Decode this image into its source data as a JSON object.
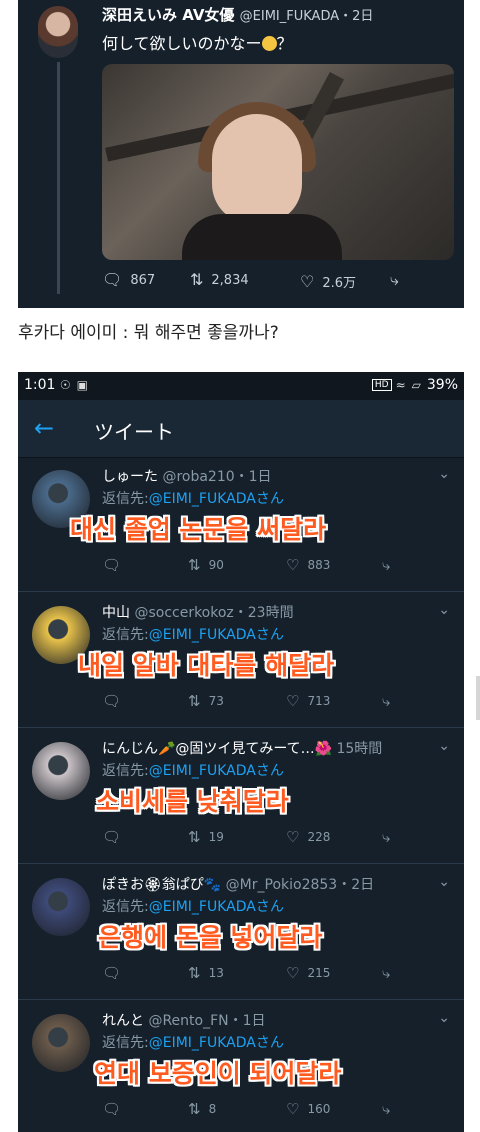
{
  "top_tweet": {
    "name": "深田えいみ AV女優",
    "handle": "@EIMI_FUKADA・2日",
    "text": "何して欲しいのかなー",
    "text_suffix": "？",
    "stats": {
      "replies": "867",
      "retweets": "2,834",
      "likes": "2.6万"
    }
  },
  "caption": "후카다 에이미 : 뭐 해주면 좋을까나?",
  "phone": {
    "status_time": "1:01",
    "status_hd": "HD",
    "status_battery": "39%",
    "header_title": "ツイート",
    "reply_to_label": "返信先:",
    "reply_to_user": "@EIMI_FUKADAさん",
    "replies": [
      {
        "name": "しゅーた",
        "handle": "@roba210・1日",
        "overlay": "대신 졸업 논문을 써달라",
        "rt": "90",
        "likes": "883",
        "avatar_color": "#4a6a8a"
      },
      {
        "name": "中山",
        "handle": "@soccerkokoz・23時間",
        "overlay": "내일 알바 대타를 해달라",
        "rt": "73",
        "likes": "713",
        "avatar_color": "#e8c24a"
      },
      {
        "name": "にんじん🥕@固ツイ見てみーて…🌺",
        "handle": "15時間",
        "overlay": "소비세를 낮춰달라",
        "rt": "19",
        "likes": "228",
        "avatar_color": "#c9c2c6"
      },
      {
        "name": "ぽきお🏵翁ぱぴ🐾",
        "handle": "@Mr_Pokio2853・2日",
        "overlay": "은행에 돈을 넣어달라",
        "rt": "13",
        "likes": "215",
        "avatar_color": "#3e4a78"
      },
      {
        "name": "れんと",
        "handle": "@Rento_FN・1日",
        "overlay": "연대 보증인이 되어달라",
        "rt": "8",
        "likes": "160",
        "avatar_color": "#6a5a4a"
      }
    ]
  }
}
